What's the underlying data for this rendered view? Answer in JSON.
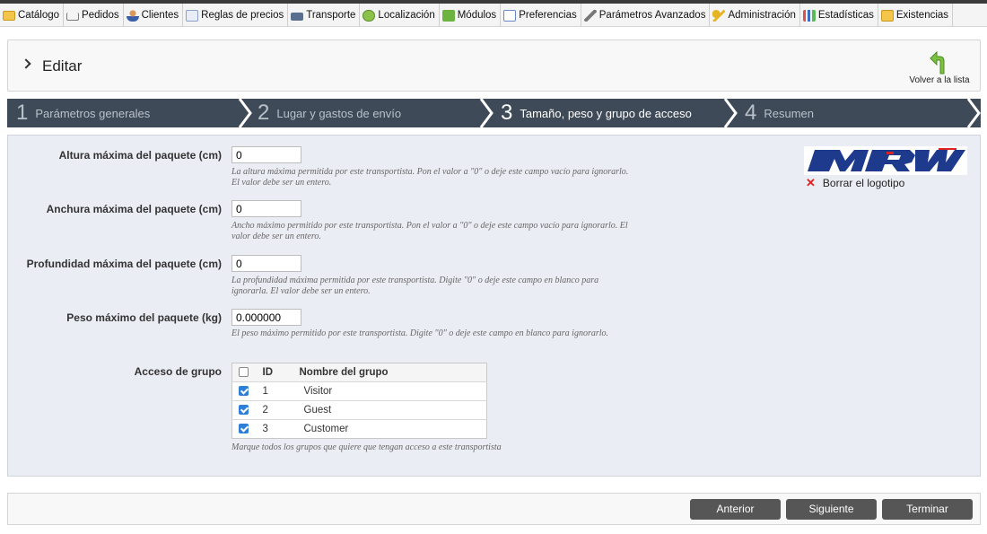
{
  "nav": {
    "items": [
      {
        "label": "Catálogo",
        "icon": "folder-icon"
      },
      {
        "label": "Pedidos",
        "icon": "cart-icon"
      },
      {
        "label": "Clientes",
        "icon": "user-icon"
      },
      {
        "label": "Reglas de precios",
        "icon": "price-rules-icon"
      },
      {
        "label": "Transporte",
        "icon": "truck-icon"
      },
      {
        "label": "Localización",
        "icon": "globe-icon"
      },
      {
        "label": "Módulos",
        "icon": "puzzle-icon"
      },
      {
        "label": "Preferencias",
        "icon": "preferences-icon"
      },
      {
        "label": "Parámetros Avanzados",
        "icon": "wrench-icon"
      },
      {
        "label": "Administración",
        "icon": "key-icon"
      },
      {
        "label": "Estadísticas",
        "icon": "bar-chart-icon"
      },
      {
        "label": "Existencias",
        "icon": "stock-icon"
      }
    ]
  },
  "header": {
    "title": "Editar",
    "back_label": "Volver a la lista"
  },
  "steps": [
    {
      "num": "1",
      "label": "Parámetros generales",
      "active": false
    },
    {
      "num": "2",
      "label": "Lugar y gastos de envío",
      "active": false
    },
    {
      "num": "3",
      "label": "Tamaño, peso y grupo de acceso",
      "active": true
    },
    {
      "num": "4",
      "label": "Resumen",
      "active": false
    }
  ],
  "form": {
    "height": {
      "label": "Altura máxima del paquete (cm)",
      "value": "0",
      "hint": "La altura máxima permitida por este transportista. Pon el valor a \"0\" o deje este campo vacío para ignorarlo. El valor debe ser un entero."
    },
    "width": {
      "label": "Anchura máxima del paquete (cm)",
      "value": "0",
      "hint": "Ancho máximo permitido por este transportista. Pon el valor a \"0\" o deje este campo vacío para ignorarlo. El valor debe ser un entero."
    },
    "depth": {
      "label": "Profundidad máxima del paquete (cm)",
      "value": "0",
      "hint": "La profundidad máxima permitida por este transportista. Digite \"0\" o deje este campo en blanco para ignorarla. El valor debe ser un entero."
    },
    "weight": {
      "label": "Peso máximo del paquete (kg)",
      "value": "0.000000",
      "hint": "El peso máximo permitido por este transportista. Digite \"0\" o deje este campo en blanco para ignorarlo."
    },
    "groups": {
      "label": "Acceso de grupo",
      "headers": {
        "id": "ID",
        "name": "Nombre del grupo"
      },
      "rows": [
        {
          "id": "1",
          "name": "Visitor",
          "checked": true
        },
        {
          "id": "2",
          "name": "Guest",
          "checked": true
        },
        {
          "id": "3",
          "name": "Customer",
          "checked": true
        }
      ],
      "hint": "Marque todos los grupos que quiere que tengan acceso a este transportista"
    }
  },
  "logo": {
    "text": "MRW",
    "delete_label": "Borrar el logotipo"
  },
  "footer": {
    "prev_label": "Anterior",
    "next_label": "Siguiente",
    "finish_label": "Terminar"
  },
  "colors": {
    "steps_bg": "#3e4a57",
    "panel_bg": "#ebedf4",
    "logo_blue": "#1d3a8c",
    "button_bg": "#565656",
    "check_blue": "#2f7fd8"
  }
}
